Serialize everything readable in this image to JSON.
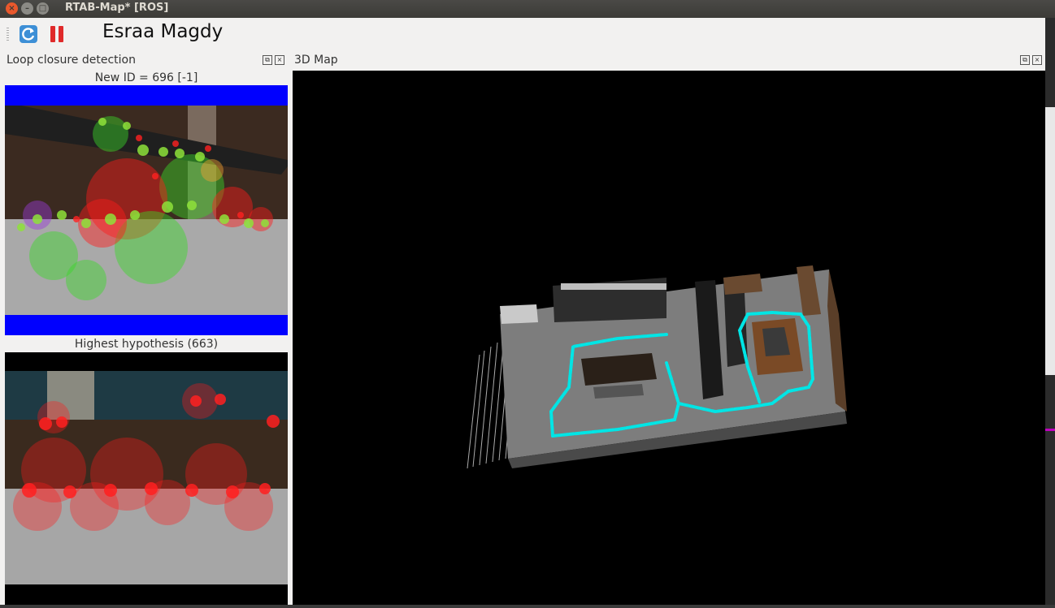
{
  "window": {
    "title": "RTAB-Map* [ROS]",
    "buttons": {
      "close": "×",
      "minimize": "–",
      "maximize": "□"
    }
  },
  "toolbar": {
    "refresh_icon": "refresh-icon",
    "pause_icon": "pause-icon",
    "label": "Esraa Magdy"
  },
  "loop_closure": {
    "title": "Loop closure detection",
    "new_id_caption": "New ID = 696 [-1]",
    "hypothesis_caption": "Highest hypothesis (663)"
  },
  "map3d": {
    "title": "3D Map"
  },
  "dock_controls": {
    "float": "⧉",
    "close": "×"
  },
  "colors": {
    "trajectory": "#00e5e5",
    "feature_match": "#39d629",
    "feature_new": "#ff1a1a",
    "border_band": "#0000ff"
  }
}
